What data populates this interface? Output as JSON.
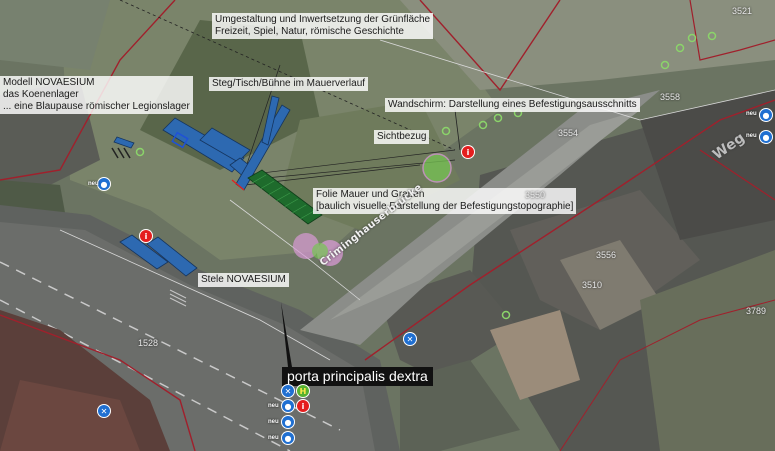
{
  "annotations": {
    "redesign_line1": "Umgestaltung und Inwertsetzung der Grünfläche",
    "redesign_line2": "Freizeit, Spiel, Natur, römische Geschichte",
    "model_line1": "Modell NOVAESIUM",
    "model_line2": "das Koenenlager",
    "model_line3": "... eine Blaupause römischer Legionslager",
    "jetty": "Steg/Tisch/Bühne im Mauerverlauf",
    "screen": "Wandschirm: Darstellung eines Befestigungsausschnitts",
    "sightline": "Sichtbezug",
    "foil_line1": "Folie Mauer und Graben",
    "foil_line2": "[baulich visuelle Darstellung der Befestigungstopographie]",
    "stele": "Stele NOVAESIUM",
    "gate_title": "porta principalis dextra"
  },
  "streets": {
    "bridge": "Criminghauserbrücke",
    "way": "Weg"
  },
  "parcels": [
    "3558",
    "3554",
    "3550",
    "3510",
    "3556",
    "3789",
    "3521",
    "1528"
  ],
  "markers": {
    "info": "i",
    "bus_stop": "H",
    "new": "neu"
  },
  "colors": {
    "model_blue": "#2d69b1",
    "parcel_red": "#a0202c",
    "sign_red": "#e41e1e",
    "icon_blue": "#1f6fd1",
    "icon_green": "#57b12f",
    "circle_pink": "#d89ad6",
    "circle_green": "#76c453",
    "foil_green": "#1e6b2c"
  }
}
